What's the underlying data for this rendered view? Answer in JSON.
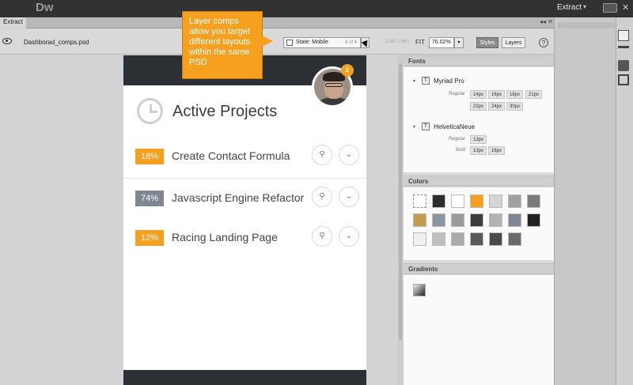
{
  "app": {
    "logo": "Dw",
    "workspace": "Extract",
    "workspace_caret": "▾",
    "close": "✕"
  },
  "tabs": {
    "active": "Extract",
    "controls": "◂◂ ✕"
  },
  "toolbar": {
    "filename": "Dashborad_comps.psd",
    "state_label": "State: Mobile",
    "state_count": "4 of 4",
    "dims": "1280 x 960",
    "fit_label": "FIT",
    "zoom_value": "76.02%",
    "caret": "▾",
    "styles_btn": "Styles",
    "layers_btn": "Layers",
    "help": "?"
  },
  "tooltip": {
    "text": "Layer comps allow you target different layouts within the same PSD"
  },
  "mobile": {
    "badge": "2",
    "title": "Active Projects",
    "search_icon": "⚲",
    "expand_icon": "⌄",
    "rows": [
      {
        "percent": "18%",
        "name": "Create Contact Formula",
        "color": "#f5a01f"
      },
      {
        "percent": "74%",
        "name": "Javascript Engine Refactor",
        "color": "#7e8794"
      },
      {
        "percent": "12%",
        "name": "Racing Landing Page",
        "color": "#f5a01f"
      }
    ]
  },
  "panel": {
    "fonts_header": "Fonts",
    "colors_header": "Colors",
    "gradients_header": "Gradients",
    "fonts": [
      {
        "name": "Myriad Pro",
        "weights": [
          {
            "label": "Regular",
            "sizes": [
              "14px",
              "16px",
              "18px",
              "21px",
              "22px",
              "24px",
              "30px"
            ]
          }
        ]
      },
      {
        "name": "HelveticaNeue",
        "weights": [
          {
            "label": "Regular",
            "sizes": [
              "13px"
            ]
          },
          {
            "label": "Bold",
            "sizes": [
              "13px",
              "16px"
            ]
          }
        ]
      }
    ],
    "swatches": [
      "#2c2c2c",
      "#ffffff",
      "#f5a01f",
      "#d4d4d4",
      "#a0a0a0",
      "#7a7a7a",
      "#c49a4e",
      "#8c96a3",
      "#9a9a9a",
      "#3c3c3c",
      "#b2b2b2",
      "#7e8794",
      "#222222",
      "#f0f0f0",
      "#c0c0c0",
      "#aaaaaa",
      "#5a5a5a",
      "#4a4a4a",
      "#6a6a6a"
    ]
  }
}
